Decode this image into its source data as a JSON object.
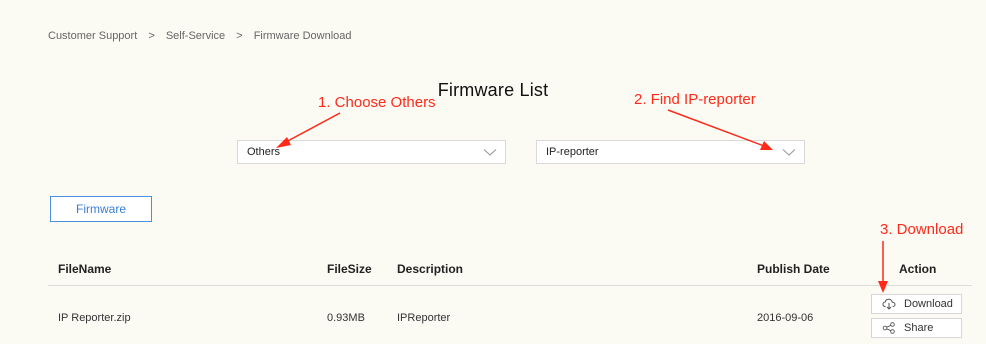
{
  "breadcrumb": {
    "items": [
      "Customer Support",
      "Self-Service",
      "Firmware Download"
    ],
    "separator": ">"
  },
  "page_title": "Firmware List",
  "annotations": {
    "step1": "1. Choose Others",
    "step2": "2. Find IP-reporter",
    "step3": "3. Download",
    "color": "#ff2a1a"
  },
  "filters": {
    "category_selected": "Others",
    "product_selected": "IP-reporter"
  },
  "tabs": {
    "firmware_label": "Firmware"
  },
  "table": {
    "columns": [
      "FileName",
      "FileSize",
      "Description",
      "Publish Date",
      "Action"
    ],
    "rows": [
      {
        "filename": "IP Reporter.zip",
        "filesize": "0.93MB",
        "description": "IPReporter",
        "publish_date": "2016-09-06"
      }
    ],
    "actions": {
      "download_label": "Download",
      "share_label": "Share"
    }
  },
  "icons": {
    "chevron": "chevron-down-icon",
    "download": "cloud-download-icon",
    "share": "share-icon"
  },
  "colors": {
    "accent_blue": "#4a8fe0",
    "annotation_red": "#ff2a1a",
    "background": "#fbfaf3"
  }
}
